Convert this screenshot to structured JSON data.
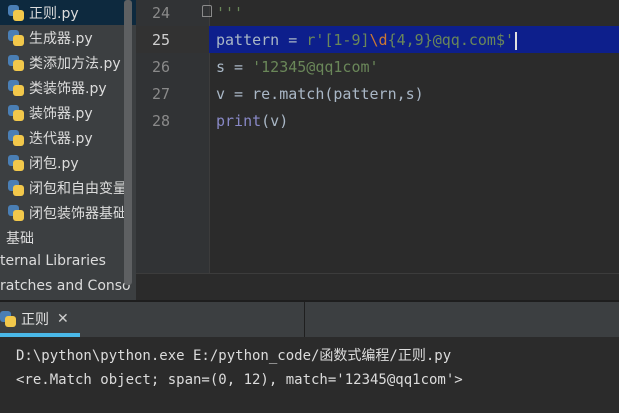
{
  "project_tree": {
    "files": [
      {
        "label": "正则.py",
        "selected": true
      },
      {
        "label": "生成器.py",
        "selected": false
      },
      {
        "label": "类添加方法.py",
        "selected": false
      },
      {
        "label": "类装饰器.py",
        "selected": false
      },
      {
        "label": "装饰器.py",
        "selected": false
      },
      {
        "label": "迭代器.py",
        "selected": false
      },
      {
        "label": "闭包.py",
        "selected": false
      },
      {
        "label": "闭包和自由变量",
        "selected": false
      },
      {
        "label": "闭包装饰器基础",
        "selected": false
      }
    ],
    "folder_label": "基础",
    "external_libraries": "ternal Libraries",
    "scratches": "ratches and Conso",
    "file_icon": "python-file-icon"
  },
  "editor": {
    "lines": [
      {
        "number": "24",
        "tokens": [
          {
            "text": "'''",
            "cls": "str"
          }
        ]
      },
      {
        "number": "25",
        "tokens": [
          {
            "text": "pattern = ",
            "cls": ""
          },
          {
            "text": "r'[1-9]",
            "cls": "str"
          },
          {
            "text": "\\d",
            "cls": "esc"
          },
          {
            "text": "{4,9}@qq.com$'",
            "cls": "str"
          }
        ]
      },
      {
        "number": "26",
        "tokens": [
          {
            "text": "s = ",
            "cls": ""
          },
          {
            "text": "'12345@qq1com'",
            "cls": "str"
          }
        ]
      },
      {
        "number": "27",
        "tokens": [
          {
            "text": "v = re.match(pattern,s)",
            "cls": ""
          }
        ]
      },
      {
        "number": "28",
        "tokens": [
          {
            "text": "print",
            "cls": "kw"
          },
          {
            "text": "(v)",
            "cls": ""
          }
        ]
      }
    ],
    "current_line": "25",
    "colors": {
      "current_line_bg": "#0d1f8c",
      "string": "#6a8759",
      "keyword_builtin": "#8888c6",
      "escape": "#cc7832",
      "default_text": "#a9b7c6"
    }
  },
  "run_window": {
    "tab_label": "正则",
    "tab_close": "✕",
    "tab_icon": "python-file-icon",
    "accent": "#4ab8e8",
    "console": {
      "command": "D:\\python\\python.exe E:/python_code/函数式编程/正则.py",
      "output": "<re.Match object; span=(0, 12), match='12345@qq1com'>"
    }
  }
}
